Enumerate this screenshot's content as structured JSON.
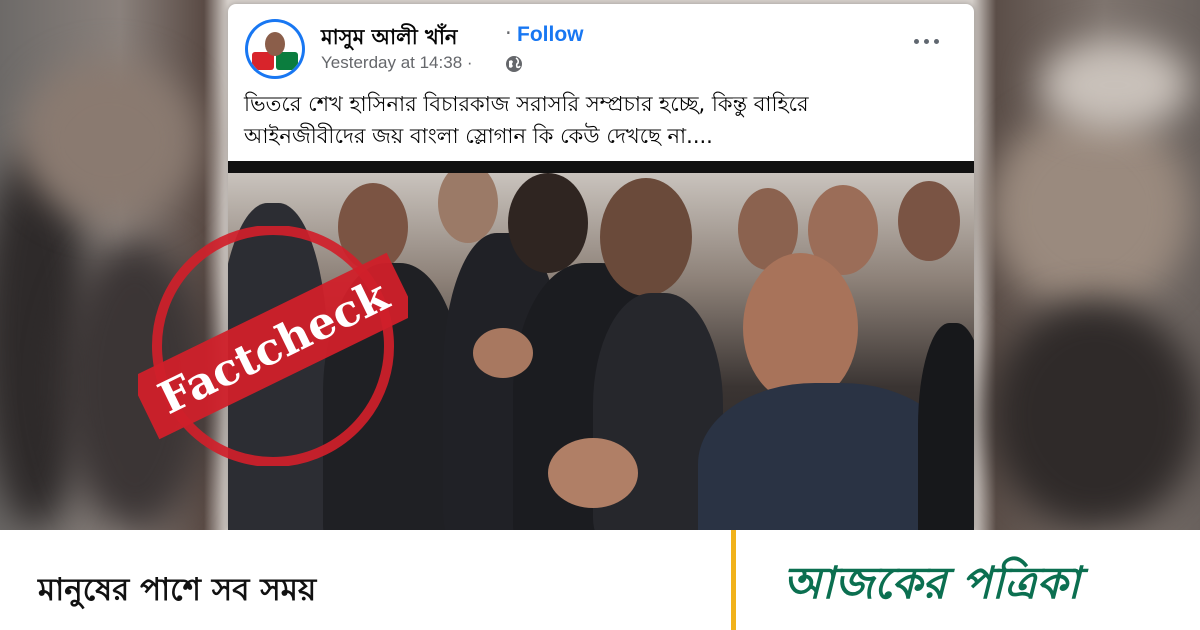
{
  "post": {
    "author": "মাসুম আলী খাঁন",
    "separator": "·",
    "follow_label": "Follow",
    "timestamp": "Yesterday at 14:38 ·",
    "text_line1": "ভিতরে শেখ হাসিনার বিচারকাজ সরাসরি সম্প্রচার হচ্ছে, কিন্তু বাহিরে",
    "text_line2": "আইনজীবীদের জয় বাংলা স্লোগান কি কেউ দেখছে না....",
    "privacy_icon": "globe-icon",
    "menu_icon": "more-options-icon"
  },
  "stamp": {
    "text": "Factcheck",
    "color": "#d0202a"
  },
  "footer": {
    "tagline": "মানুষের পাশে সব সময়",
    "brand": "আজকের পত্রিকা",
    "brand_color": "#0b6f50",
    "divider_color": "#f1b21b"
  },
  "colors": {
    "accent": "#1877f2",
    "text": "#050505",
    "muted": "#65676b"
  }
}
